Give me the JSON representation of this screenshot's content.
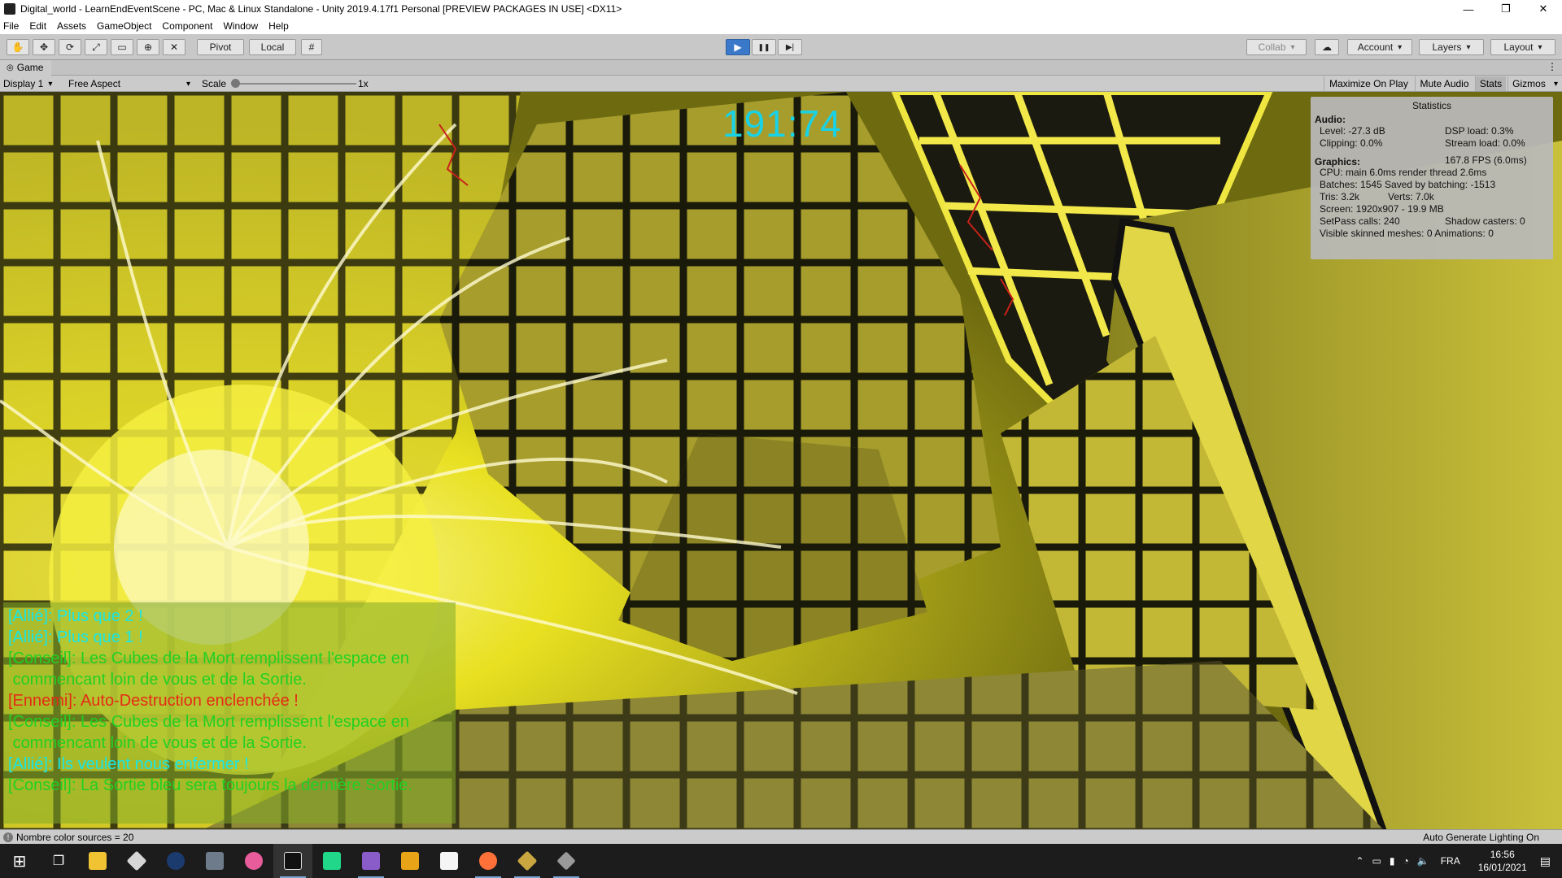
{
  "window": {
    "title": "Digital_world - LearnEndEventScene - PC, Mac & Linux Standalone - Unity 2019.4.17f1 Personal [PREVIEW PACKAGES IN USE] <DX11>",
    "minimize": "—",
    "maximize": "❐",
    "close": "✕"
  },
  "menu": [
    "File",
    "Edit",
    "Assets",
    "GameObject",
    "Component",
    "Window",
    "Help"
  ],
  "toolbar": {
    "pivot_label": "Pivot",
    "local_label": "Local",
    "collab_label": "Collab",
    "account_label": "Account",
    "layers_label": "Layers",
    "layout_label": "Layout",
    "play_icon": "▶",
    "pause_icon": "❚❚",
    "step_icon": "▶|"
  },
  "game_tab": {
    "label": "Game",
    "display": "Display 1",
    "aspect": "Free Aspect",
    "scale_label": "Scale",
    "scale_value": "1x",
    "scale_level": 0.0,
    "maximize_on_play": "Maximize On Play",
    "mute_audio": "Mute Audio",
    "stats": "Stats",
    "gizmos": "Gizmos"
  },
  "hud": {
    "timer": "191:74"
  },
  "stats": {
    "title": "Statistics",
    "audio_header": "Audio:",
    "level": "Level: -27.3 dB",
    "dsp_load": "DSP load: 0.3%",
    "clipping": "Clipping: 0.0%",
    "stream_load": "Stream load: 0.0%",
    "graphics_header": "Graphics:",
    "fps": "167.8 FPS (6.0ms)",
    "cpu": "CPU: main 6.0ms  render thread 2.6ms",
    "batches": "Batches: 1545   Saved by batching: -1513",
    "tris": "Tris: 3.2k",
    "verts": "Verts: 7.0k",
    "screen": "Screen: 1920x907 - 19.9 MB",
    "setpass": "SetPass calls: 240",
    "shadow_casters": "Shadow casters: 0",
    "skinned": "Visible skinned meshes: 0  Animations: 0"
  },
  "chat": [
    {
      "tag": "[Allié]: ",
      "text": "Plus que 2 !",
      "color": "#18e6e6"
    },
    {
      "tag": "[Allié]: ",
      "text": "Plus que 1 !",
      "color": "#18e6e6"
    },
    {
      "tag": "[Conseil]: ",
      "text": "Les Cubes de la Mort remplissent l'espace en\n commencant loin de vous et de la Sortie.",
      "color": "#22d022"
    },
    {
      "tag": "[Ennemi]: ",
      "text": "Auto-Destruction enclenchée !",
      "color": "#e62a14"
    },
    {
      "tag": "[Conseil]: ",
      "text": "Les Cubes de la Mort remplissent l'espace en\n commencant loin de vous et de la Sortie.",
      "color": "#22d022"
    },
    {
      "tag": "[Allié]: ",
      "text": "Ils veulent nous enfermer !",
      "color": "#18e6e6"
    },
    {
      "tag": "[Conseil]: ",
      "text": "La Sortie bleu sera toujours la dernière Sortie.",
      "color": "#22d022"
    }
  ],
  "statusbar": {
    "message": "Nombre color sources = 20",
    "right": "Auto Generate Lighting On"
  },
  "taskbar": {
    "language": "FRA",
    "time": "16:56",
    "date": "16/01/2021",
    "apps": [
      "start-icon",
      "task-view-icon",
      "file-explorer-icon",
      "git-icon",
      "steam-icon",
      "game-app-icon",
      "osu-icon",
      "unity-icon",
      "pycharm-icon",
      "visual-studio-icon",
      "code-editor-icon",
      "notepad-icon",
      "firefox-icon",
      "git-gui-icon",
      "inkscape-icon"
    ]
  }
}
